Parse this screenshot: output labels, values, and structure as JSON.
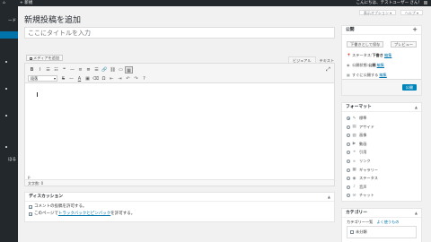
{
  "adminbar": {
    "home": "⌂",
    "new_label": "+ 新規",
    "howdy": "こんにちは、テストユーザー さん！"
  },
  "sidebar": {
    "items": [
      {
        "label": ""
      },
      {
        "label": "ード"
      },
      {
        "label": ""
      },
      {
        "label": ""
      },
      {
        "label": ""
      },
      {
        "label": ""
      },
      {
        "label": "ほる"
      }
    ]
  },
  "screen_options": {
    "display_label": "表示オプション ▾",
    "help_label": "ヘルプ ▾"
  },
  "page_title": "新規投稿を追加",
  "title_input": {
    "placeholder": "ここにタイトルを入力",
    "value": ""
  },
  "editor": {
    "media_button": "メディアを追加",
    "tabs": {
      "visual": "ビジュアル",
      "text": "テキスト"
    },
    "toolbar_row1": [
      {
        "icon": "bold-icon",
        "glyph": "B"
      },
      {
        "icon": "italic-icon",
        "glyph": "I"
      },
      {
        "icon": "bullet-list-icon",
        "glyph": "☰"
      },
      {
        "icon": "numbered-list-icon",
        "glyph": "☷"
      },
      {
        "icon": "blockquote-icon",
        "glyph": "❝"
      },
      {
        "icon": "horizontal-line-icon",
        "glyph": "—"
      },
      {
        "icon": "align-left-icon",
        "glyph": "≡"
      },
      {
        "icon": "align-center-icon",
        "glyph": "≣"
      },
      {
        "icon": "align-right-icon",
        "glyph": "☰"
      },
      {
        "icon": "insert-link-icon",
        "glyph": "🔗"
      },
      {
        "icon": "remove-link-icon",
        "glyph": "⛓"
      },
      {
        "icon": "read-more-icon",
        "glyph": "▭"
      },
      {
        "icon": "toolbar-toggle-icon",
        "glyph": "▦"
      }
    ],
    "toolbar_row2": [
      {
        "icon": "strikethrough-icon",
        "glyph": "S"
      },
      {
        "icon": "horizontal-rule-icon",
        "glyph": "—"
      },
      {
        "icon": "text-color-icon",
        "glyph": "A"
      },
      {
        "icon": "paste-text-icon",
        "glyph": "▣"
      },
      {
        "icon": "clear-formatting-icon",
        "glyph": "⌫"
      },
      {
        "icon": "special-character-icon",
        "glyph": "Ω"
      },
      {
        "icon": "outdent-icon",
        "glyph": "⇤"
      },
      {
        "icon": "indent-icon",
        "glyph": "⇥"
      },
      {
        "icon": "undo-icon",
        "glyph": "↶"
      },
      {
        "icon": "redo-icon",
        "glyph": "↷"
      },
      {
        "icon": "help-icon",
        "glyph": "?"
      }
    ],
    "format_select": "段落",
    "expand_icon": "⤢",
    "path": "p",
    "word_count": "文字数: 0"
  },
  "discussion": {
    "title": "ディスカッション",
    "allow_comments": "コメントの投稿を許可する。",
    "allow_pings_prefix": "このページで",
    "allow_pings_link": "トラックバックとピンバック",
    "allow_pings_suffix": "を許可する。"
  },
  "publish": {
    "title": "公開",
    "save_draft": "下書きとして保存",
    "preview": "プレビュー",
    "status_label": "ステータス: ",
    "status_value": "下書き",
    "visibility_label": "公開状態: ",
    "visibility_value": "公開",
    "schedule_label": "すぐに公開する",
    "edit_label": "編集",
    "publish_button": "公開"
  },
  "format": {
    "title": "フォーマット",
    "options": [
      {
        "label": "標準",
        "icon": "pin-icon",
        "glyph": "✎",
        "selected": true
      },
      {
        "label": "アサイド",
        "icon": "aside-icon",
        "glyph": "▤",
        "selected": false
      },
      {
        "label": "画像",
        "icon": "image-icon",
        "glyph": "▨",
        "selected": false
      },
      {
        "label": "動画",
        "icon": "video-icon",
        "glyph": "▶",
        "selected": false
      },
      {
        "label": "引用",
        "icon": "quote-icon",
        "glyph": "❝",
        "selected": false
      },
      {
        "label": "リンク",
        "icon": "link-icon",
        "glyph": "∞",
        "selected": false
      },
      {
        "label": "ギャラリー",
        "icon": "gallery-icon",
        "glyph": "▦",
        "selected": false
      },
      {
        "label": "ステータス",
        "icon": "status-icon",
        "glyph": "◉",
        "selected": false
      },
      {
        "label": "音声",
        "icon": "audio-icon",
        "glyph": "♪",
        "selected": false
      },
      {
        "label": "チャット",
        "icon": "chat-icon",
        "glyph": "✉",
        "selected": false
      }
    ]
  },
  "category": {
    "title": "カテゴリー",
    "tab_all": "カテゴリー一覧",
    "tab_popular": "よく使うもの",
    "items": [
      {
        "label": "未分類"
      }
    ]
  },
  "colors": {
    "admin_dark": "#23282d",
    "accent_blue": "#0073aa",
    "publish_blue": "#0085ba"
  }
}
